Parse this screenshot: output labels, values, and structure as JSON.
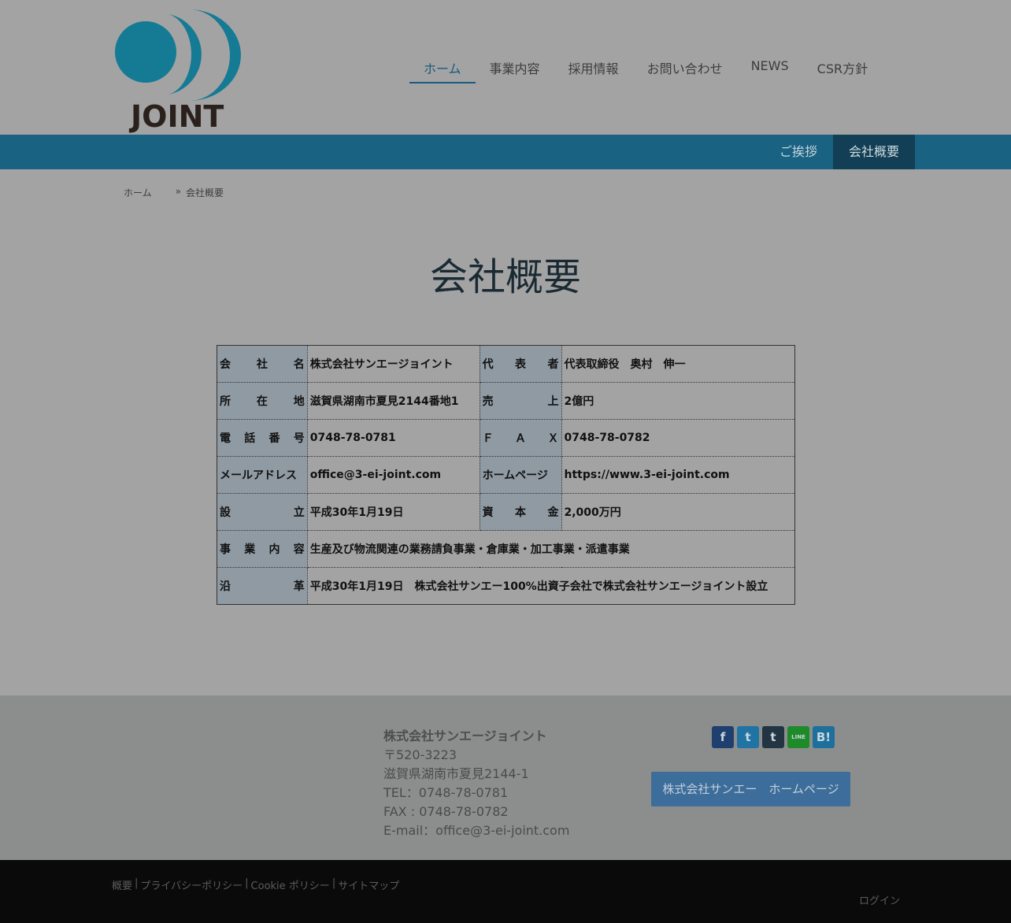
{
  "header": {
    "logo_text": "JOINT",
    "nav": [
      {
        "label": "ホーム",
        "active": true
      },
      {
        "label": "事業内容",
        "active": false
      },
      {
        "label": "採用情報",
        "active": false
      },
      {
        "label": "お問い合わせ",
        "active": false
      },
      {
        "label": "NEWS",
        "active": false
      },
      {
        "label": "CSR方針",
        "active": false
      }
    ]
  },
  "subnav": [
    {
      "label": "ご挨拶",
      "active": false
    },
    {
      "label": "会社概要",
      "active": true
    }
  ],
  "breadcrumb": {
    "home": "ホーム",
    "separator": "»",
    "current": "会社概要"
  },
  "page_title": "会社概要",
  "table": {
    "rows": [
      {
        "l1": [
          "会",
          "社",
          "名"
        ],
        "v1": "株式会社サンエージョイント",
        "l2": [
          "代",
          "表",
          "者"
        ],
        "v2": "代表取締役　奥村　伸一"
      },
      {
        "l1": [
          "所",
          "在",
          "地"
        ],
        "v1": "滋賀県湖南市夏見2144番地1",
        "l2": [
          "売",
          "上"
        ],
        "v2": "2億円"
      },
      {
        "l1": [
          "電",
          "話",
          "番",
          "号"
        ],
        "v1": "0748-78-0781",
        "l2": [
          "Ｆ",
          "Ａ",
          "Ｘ"
        ],
        "v2": "0748-78-0782"
      },
      {
        "l1": [
          "メールアドレス"
        ],
        "v1": "office@3-ei-joint.com",
        "l2": [
          "ホームページ"
        ],
        "v2": "https://www.3-ei-joint.com"
      },
      {
        "l1": [
          "設",
          "立"
        ],
        "v1": "平成30年1月19日",
        "l2": [
          "資",
          "本",
          "金"
        ],
        "v2": "2,000万円"
      }
    ],
    "wide_rows": [
      {
        "label": [
          "事",
          "業",
          "内",
          "容"
        ],
        "value": "生産及び物流関連の業務請負事業・倉庫業・加工事業・派遣事業"
      },
      {
        "label": [
          "沿",
          "革"
        ],
        "value": "平成30年1月19日　株式会社サンエー100%出資子会社で株式会社サンエージョイント設立"
      }
    ]
  },
  "footer": {
    "company_name": "株式会社サンエージョイント",
    "postal": "〒520-3223",
    "address": "滋賀県湖南市夏見2144-1",
    "tel": "TEL：0748-78-0781",
    "fax": "FAX : 0748-78-0782",
    "email": "E-mail：office@3-ei-joint.com",
    "social": [
      {
        "name": "facebook-icon",
        "glyph": "f",
        "color": "#1f3f6e"
      },
      {
        "name": "twitter-icon",
        "glyph": "t",
        "color": "#1f74a4"
      },
      {
        "name": "tumblr-icon",
        "glyph": "t",
        "color": "#233543"
      },
      {
        "name": "line-icon",
        "glyph": "LINE",
        "color": "#1f8a2a"
      },
      {
        "name": "hatena-icon",
        "glyph": "B!",
        "color": "#1d6f9c"
      }
    ],
    "hp_button": "株式会社サンエー　ホームページ"
  },
  "bottom": {
    "links": [
      "概要",
      "プライバシーポリシー",
      "Cookie ポリシー",
      "サイトマップ"
    ],
    "separator": "|",
    "login": "ログイン"
  },
  "colors": {
    "accent": "#1a6282",
    "nav_active": "#1a5a7e",
    "table_header": "#8f9aa3",
    "footer_bg": "#8c8e8d",
    "bottom_bg": "#0a0a0a"
  }
}
